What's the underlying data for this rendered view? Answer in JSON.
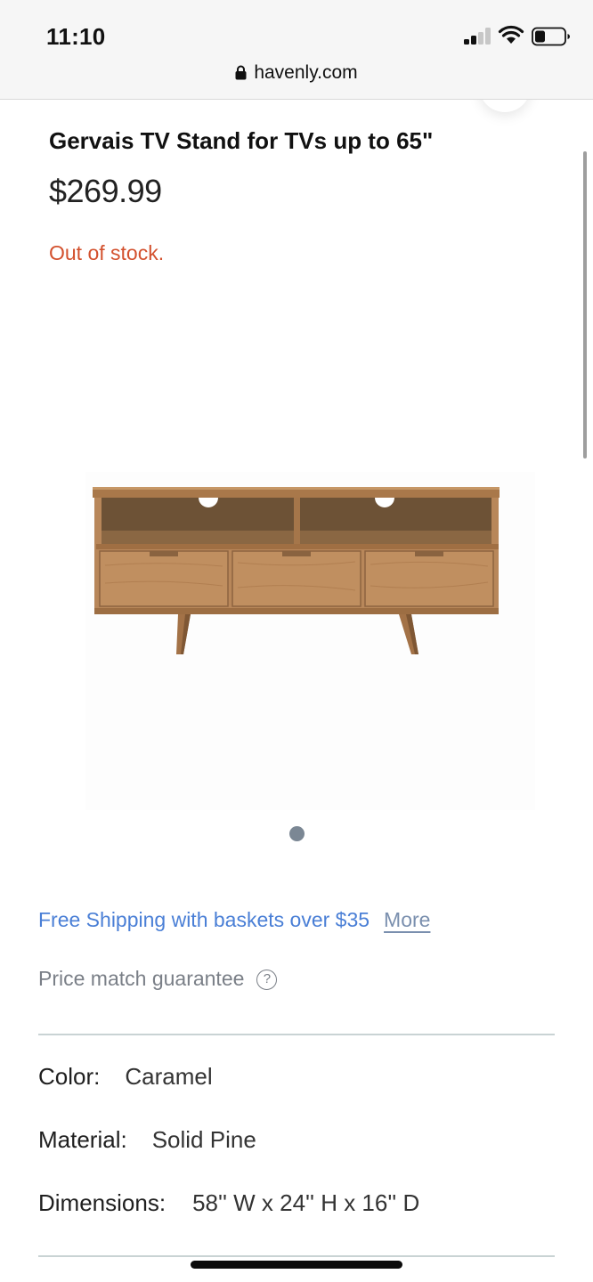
{
  "status_bar": {
    "time": "11:10"
  },
  "browser": {
    "url": "havenly.com"
  },
  "product": {
    "title": "Gervais TV Stand for TVs up to 65\"",
    "price": "$269.99",
    "stock_status": "Out of stock.",
    "image_alt_icon": "tv-stand-image",
    "carousel": {
      "count": 1,
      "active": 1
    }
  },
  "shipping": {
    "text": "Free Shipping with baskets over $35",
    "more_label": "More"
  },
  "price_match": {
    "text": "Price match guarantee",
    "help_icon": "?"
  },
  "specs": [
    {
      "label": "Color:",
      "value": "Caramel"
    },
    {
      "label": "Material:",
      "value": "Solid Pine"
    },
    {
      "label": "Dimensions:",
      "value": "58'' W x 24'' H x 16'' D"
    }
  ],
  "colors": {
    "stock_text": "#d3512e",
    "link_blue": "#4a7fd6",
    "muted_gray": "#7a7f87",
    "wood": "#b8875a"
  }
}
